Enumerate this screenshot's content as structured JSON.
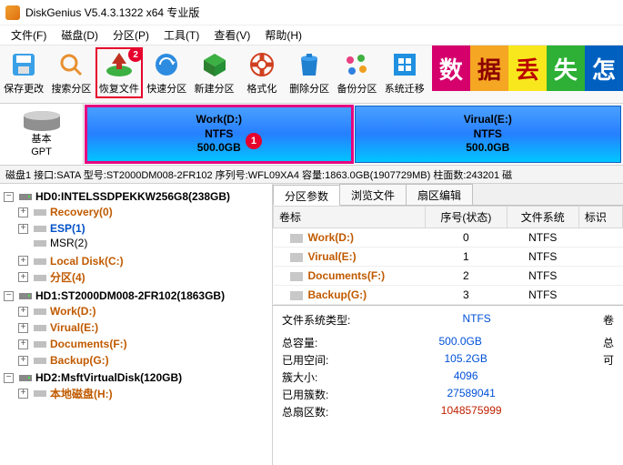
{
  "title": "DiskGenius V5.4.3.1322 x64 专业版",
  "menu": [
    "文件(F)",
    "磁盘(D)",
    "分区(P)",
    "工具(T)",
    "查看(V)",
    "帮助(H)"
  ],
  "toolbar": {
    "save": "保存更改",
    "search": "搜索分区",
    "recover": "恢复文件",
    "quick": "快速分区",
    "newpart": "新建分区",
    "format": "格式化",
    "delete": "删除分区",
    "backup": "备份分区",
    "migrate": "系统迁移",
    "badge2": "2"
  },
  "banner": [
    "数",
    "据",
    "丢",
    "失",
    "怎"
  ],
  "disk_left": {
    "l1": "基本",
    "l2": "GPT"
  },
  "partitions": [
    {
      "name": "Work(D:)",
      "fs": "NTFS",
      "size": "500.0GB",
      "sel": true,
      "mark": "1"
    },
    {
      "name": "Virual(E:)",
      "fs": "NTFS",
      "size": "500.0GB",
      "sel": false
    }
  ],
  "diskinfo": "磁盘1 接口:SATA 型号:ST2000DM008-2FR102 序列号:WFL09XA4 容量:1863.0GB(1907729MB) 柱面数:243201 磁",
  "tree": {
    "hd0": "HD0:INTELSSDPEKKW256G8(238GB)",
    "hd0_items": [
      "Recovery(0)",
      "ESP(1)",
      "MSR(2)",
      "Local Disk(C:)",
      "分区(4)"
    ],
    "hd1": "HD1:ST2000DM008-2FR102(1863GB)",
    "hd1_items": [
      "Work(D:)",
      "Virual(E:)",
      "Documents(F:)",
      "Backup(G:)"
    ],
    "hd2": "HD2:MsftVirtualDisk(120GB)",
    "hd2_items": [
      "本地磁盘(H:)"
    ]
  },
  "tabs": [
    "分区参数",
    "浏览文件",
    "扇区编辑"
  ],
  "grid": {
    "headers": [
      "卷标",
      "序号(状态)",
      "文件系统",
      "标识"
    ],
    "rows": [
      {
        "name": "Work(D:)",
        "seq": "0",
        "fs": "NTFS"
      },
      {
        "name": "Virual(E:)",
        "seq": "1",
        "fs": "NTFS"
      },
      {
        "name": "Documents(F:)",
        "seq": "2",
        "fs": "NTFS"
      },
      {
        "name": "Backup(G:)",
        "seq": "3",
        "fs": "NTFS"
      }
    ]
  },
  "details": {
    "fstype_l": "文件系统类型:",
    "fstype_v": "NTFS",
    "vol_l": "卷",
    "cap_l": "总容量:",
    "cap_v": "500.0GB",
    "cap_r": "总",
    "used_l": "已用空间:",
    "used_v": "105.2GB",
    "used_r": "可",
    "cluster_l": "簇大小:",
    "cluster_v": "4096",
    "usedclu_l": "已用簇数:",
    "usedclu_v": "27589041",
    "tot_l": "总扇区数:",
    "tot_v": "1048575999"
  }
}
